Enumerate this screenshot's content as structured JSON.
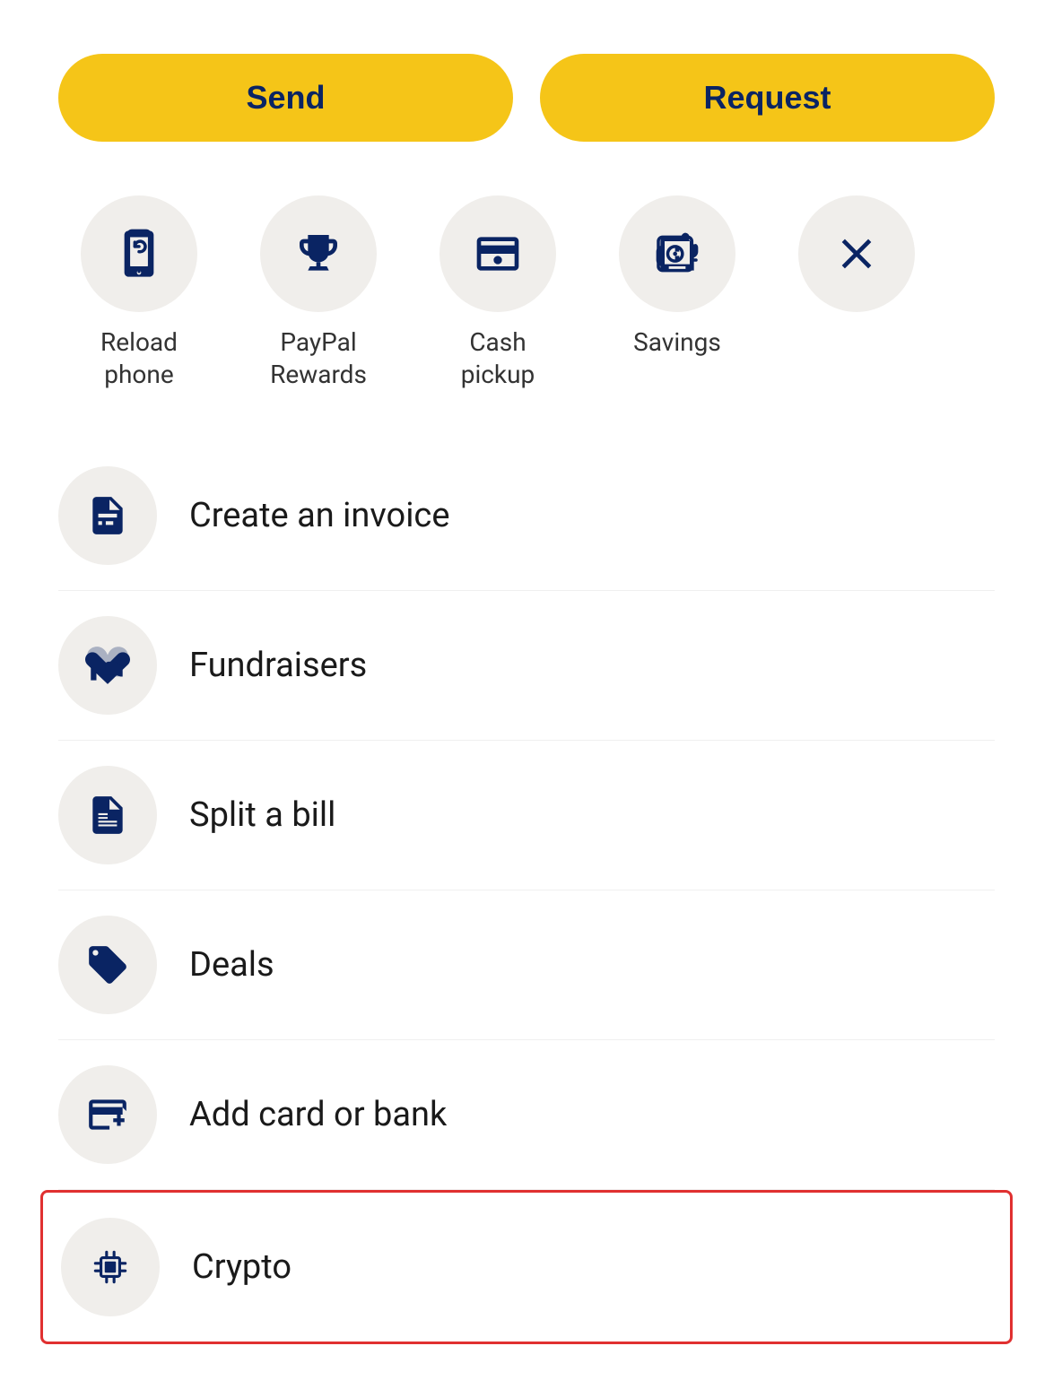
{
  "buttons": {
    "send_label": "Send",
    "request_label": "Request"
  },
  "quick_actions": [
    {
      "id": "reload-phone",
      "label": "Reload\nphone",
      "icon": "reload-phone-icon"
    },
    {
      "id": "paypal-rewards",
      "label": "PayPal\nRewards",
      "icon": "trophy-icon"
    },
    {
      "id": "cash-pickup",
      "label": "Cash\npickup",
      "icon": "cash-pickup-icon"
    },
    {
      "id": "savings",
      "label": "Savings",
      "icon": "savings-icon"
    },
    {
      "id": "close",
      "label": "",
      "icon": "close-icon"
    }
  ],
  "menu_items": [
    {
      "id": "create-invoice",
      "label": "Create an invoice",
      "icon": "invoice-icon"
    },
    {
      "id": "fundraisers",
      "label": "Fundraisers",
      "icon": "fundraisers-icon"
    },
    {
      "id": "split-bill",
      "label": "Split a bill",
      "icon": "split-bill-icon"
    },
    {
      "id": "deals",
      "label": "Deals",
      "icon": "deals-icon"
    },
    {
      "id": "add-card-bank",
      "label": "Add card or bank",
      "icon": "add-card-icon"
    },
    {
      "id": "crypto",
      "label": "Crypto",
      "icon": "crypto-icon",
      "highlighted": true
    }
  ],
  "colors": {
    "brand_yellow": "#F5C518",
    "brand_navy": "#0a2463",
    "icon_bg": "#f0eeeb",
    "highlight_border": "#e03030"
  }
}
